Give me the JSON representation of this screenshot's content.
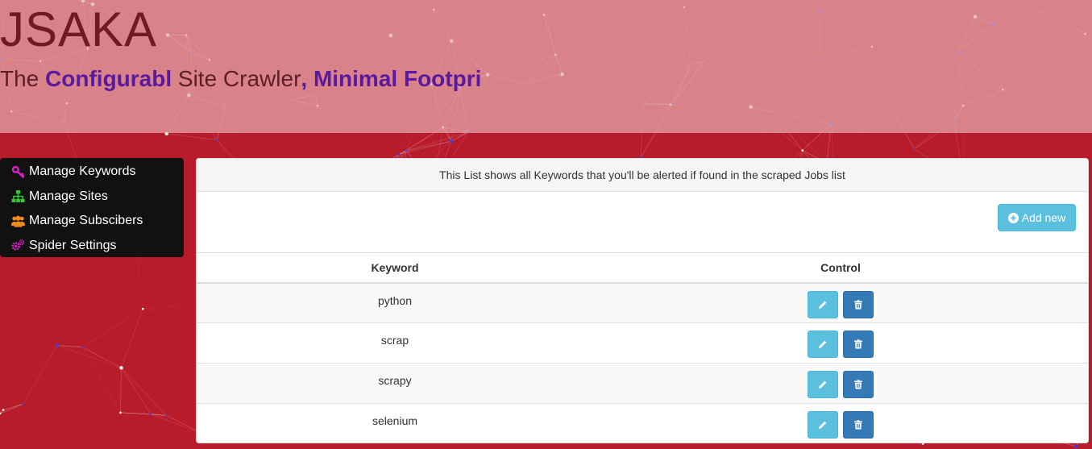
{
  "header": {
    "title": "JSAKA",
    "tagline": {
      "part1": "The ",
      "part2": "Configurabl",
      "part3": " Site Crawler",
      "part4": ", Minimal Footpri"
    }
  },
  "sidebar": {
    "items": [
      {
        "label": "Manage Keywords",
        "icon": "key-icon",
        "color": "#e020d0"
      },
      {
        "label": "Manage Sites",
        "icon": "sitemap-icon",
        "color": "#3cc63c"
      },
      {
        "label": "Manage Subscibers",
        "icon": "users-icon",
        "color": "#f08a24"
      },
      {
        "label": "Spider Settings",
        "icon": "cogs-icon",
        "color": "#e020d0"
      }
    ]
  },
  "panel": {
    "heading": "This List shows all Keywords that you'll be alerted if found in the scraped Jobs list",
    "add_button": "Add new",
    "table": {
      "columns": [
        "Keyword",
        "Control"
      ],
      "rows": [
        "python",
        "scrap",
        "scrapy",
        "selenium"
      ]
    }
  },
  "colors": {
    "page_background": "#b81c2b",
    "header_overlay": "#e6aaaf",
    "accent_purple": "#5a1aa0",
    "info_button": "#5bc0de",
    "primary_button": "#337ab7"
  }
}
